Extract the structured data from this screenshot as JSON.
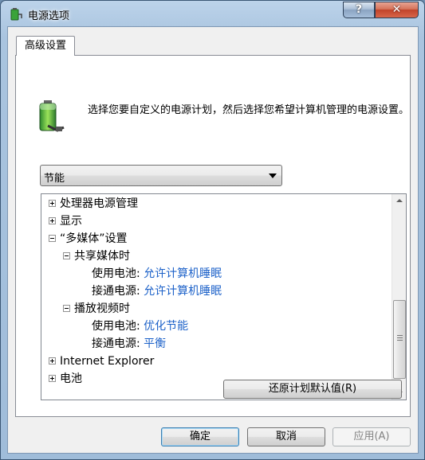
{
  "window": {
    "title": "电源选项",
    "help_label": "?",
    "close_label": "✕"
  },
  "tabs": [
    {
      "label": "高级设置"
    }
  ],
  "description": "选择您要自定义的电源计划，然后选择您希望计算机管理的电源设置。",
  "plan_select": {
    "selected": "节能"
  },
  "tree": {
    "items": [
      {
        "label": "处理器电源管理",
        "state": "collapsed"
      },
      {
        "label": "显示",
        "state": "collapsed"
      },
      {
        "label": "“多媒体”设置",
        "state": "expanded"
      },
      {
        "label": "共享媒体时",
        "state": "expanded"
      },
      {
        "label": "使用电池:",
        "value": "允许计算机睡眠"
      },
      {
        "label": "接通电源:",
        "value": "允许计算机睡眠"
      },
      {
        "label": "播放视频时",
        "state": "expanded"
      },
      {
        "label": "使用电池:",
        "value": "优化节能"
      },
      {
        "label": "接通电源:",
        "value": "平衡"
      },
      {
        "label": "Internet Explorer",
        "state": "collapsed"
      },
      {
        "label": "电池",
        "state": "collapsed"
      }
    ]
  },
  "buttons": {
    "restore": "还原计划默认值(R)",
    "ok": "确定",
    "cancel": "取消",
    "apply": "应用(A)"
  },
  "colors": {
    "link": "#1d62c9",
    "titlebar": "#a9c4df",
    "close": "#c1432a"
  }
}
